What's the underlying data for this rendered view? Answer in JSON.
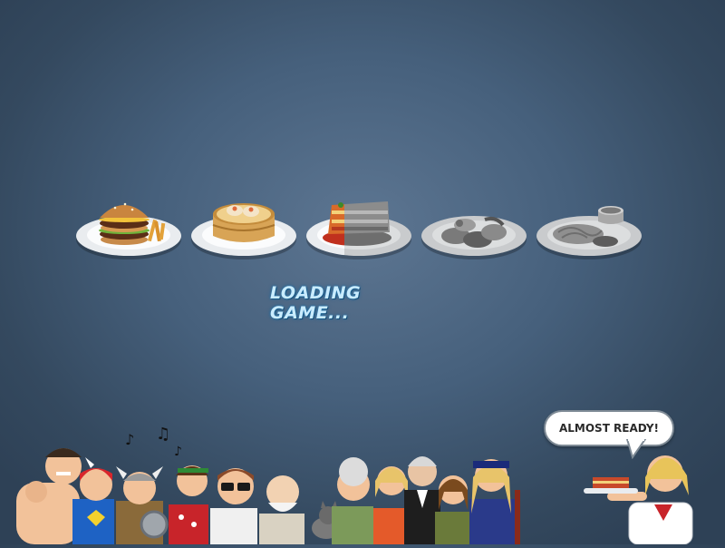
{
  "loading": {
    "label": "LOADING GAME..."
  },
  "speech": {
    "text": "ALMOST READY!"
  },
  "progress": {
    "fraction": 0.45,
    "dishes_total": 5
  },
  "dishes": [
    {
      "name": "burger-plate",
      "loaded": true
    },
    {
      "name": "dim-sum-plate",
      "loaded": true
    },
    {
      "name": "lasagna-plate",
      "loaded": "partial"
    },
    {
      "name": "stir-fry-plate",
      "loaded": false
    },
    {
      "name": "pasta-plate",
      "loaded": false
    }
  ],
  "icons": {
    "music_notes": "music-note-icon"
  },
  "colors": {
    "background": "#46607c",
    "loading_text": "#c9ecff",
    "loading_glow": "#1e6394"
  }
}
